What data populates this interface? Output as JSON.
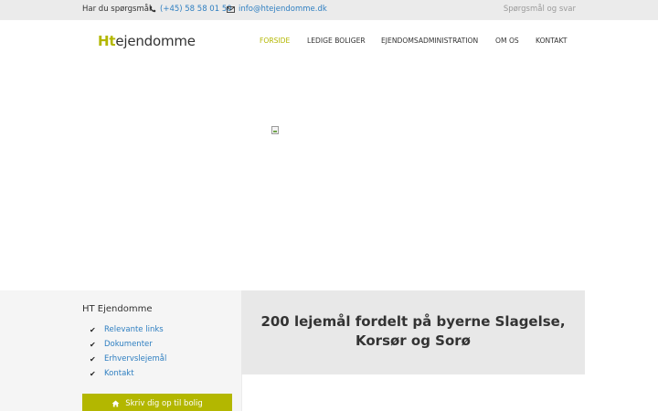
{
  "topbar": {
    "lead": "Har du spørgsmål",
    "phone": "(+45) 58 58 01 50",
    "email": "info@htejendomme.dk",
    "faq": "Spørgsmål og svar"
  },
  "header": {
    "logo_h": "Ht",
    "logo_rest": "ejendomme",
    "nav": [
      {
        "label": "FORSIDE",
        "active": true
      },
      {
        "label": "LEDIGE BOLIGER",
        "active": false
      },
      {
        "label": "EJENDOMSADMINISTRATION",
        "active": false
      },
      {
        "label": "OM OS",
        "active": false
      },
      {
        "label": "KONTAKT",
        "active": false
      }
    ]
  },
  "sidebar": {
    "title": "HT Ejendomme",
    "links": [
      "Relevante links",
      "Dokumenter",
      "Erhvervslejemål",
      "Kontakt"
    ],
    "cta": "Skriv dig op til bolig"
  },
  "main": {
    "headline": "200 lejemål fordelt på byerne Slagelse, Korsør og Sorø"
  },
  "colors": {
    "accent": "#b3b700",
    "link": "#2f7fc1",
    "topbar_bg": "#ebebeb",
    "panel_bg": "#e8e8e8"
  }
}
